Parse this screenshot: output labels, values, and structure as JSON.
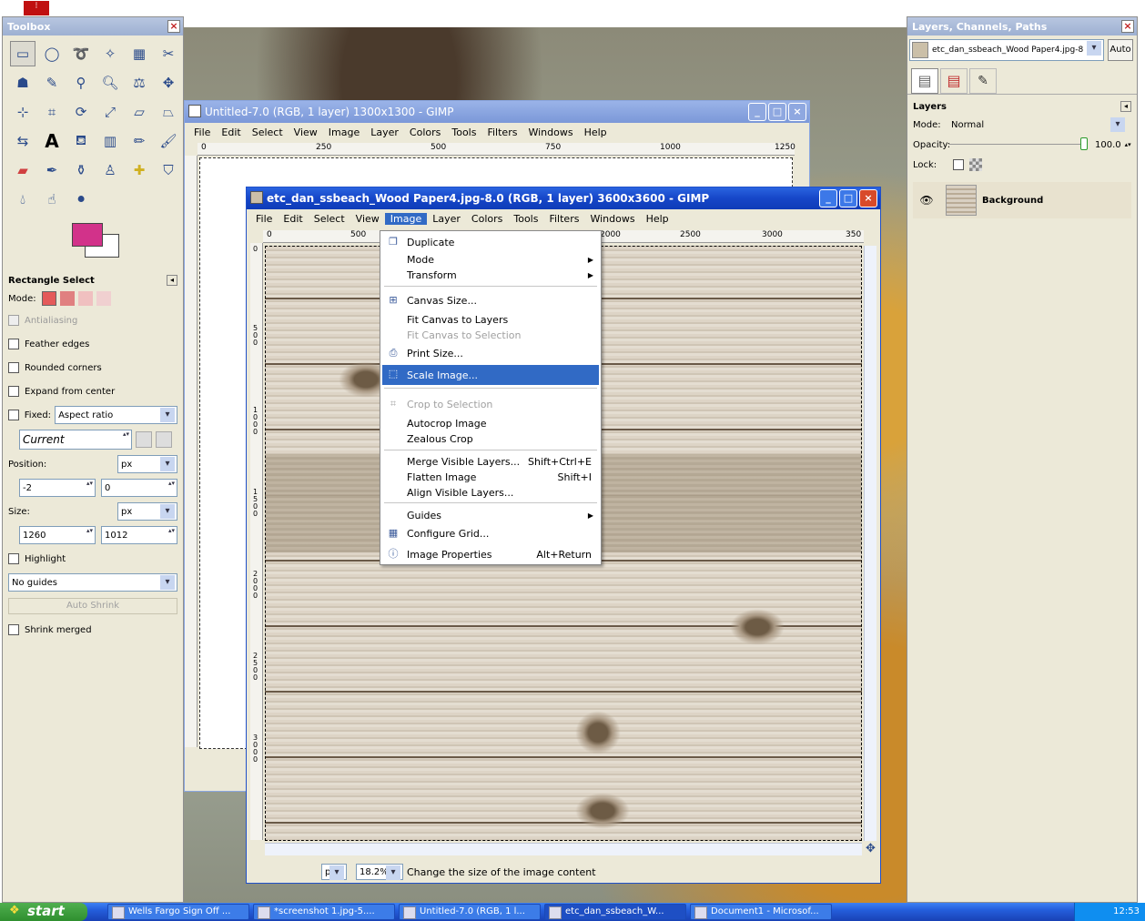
{
  "toolbox": {
    "title": "Toolbox",
    "tools": [
      "rect-select",
      "ellipse-select",
      "free-select",
      "fuzzy-select",
      "select-by-color",
      "scissors",
      "foreground-select",
      "paths",
      "color-picker",
      "zoom",
      "measure",
      "move",
      "align",
      "crop",
      "rotate",
      "scale",
      "shear",
      "perspective",
      "flip",
      "text",
      "bucket-fill",
      "blend",
      "pencil",
      "paintbrush",
      "eraser",
      "airbrush",
      "ink",
      "clone",
      "heal",
      "perspective-clone",
      "blur",
      "smudge",
      "dodge-burn"
    ],
    "colors": {
      "foreground": "#d2328a",
      "background": "#ffffff"
    },
    "options": {
      "title": "Rectangle Select",
      "mode_label": "Mode:",
      "antialiasing": "Antialiasing",
      "feather_edges": "Feather edges",
      "rounded_corners": "Rounded corners",
      "expand_from_center": "Expand from center",
      "fixed_label": "Fixed:",
      "fixed_value": "Aspect ratio",
      "current_value": "Current",
      "position_label": "Position:",
      "position_unit": "px",
      "position_x": "-2",
      "position_y": "0",
      "size_label": "Size:",
      "size_unit": "px",
      "size_w": "1260",
      "size_h": "1012",
      "highlight": "Highlight",
      "guides_value": "No guides",
      "auto_shrink": "Auto Shrink",
      "shrink_merged": "Shrink merged"
    }
  },
  "back_window": {
    "title": "Untitled-7.0 (RGB, 1 layer) 1300x1300 - GIMP",
    "menus": [
      "File",
      "Edit",
      "Select",
      "View",
      "Image",
      "Layer",
      "Colors",
      "Tools",
      "Filters",
      "Windows",
      "Help"
    ],
    "ruler_h": [
      "0",
      "250",
      "500",
      "750",
      "1000",
      "1250"
    ]
  },
  "front_window": {
    "title": "etc_dan_ssbeach_Wood Paper4.jpg-8.0 (RGB, 1 layer) 3600x3600 - GIMP",
    "menus": [
      "File",
      "Edit",
      "Select",
      "View",
      "Image",
      "Layer",
      "Colors",
      "Tools",
      "Filters",
      "Windows",
      "Help"
    ],
    "ruler_h": [
      "0",
      "500",
      "2000",
      "2500",
      "3000",
      "350"
    ],
    "ruler_v": [
      "0",
      "500",
      "1000",
      "1500",
      "2000",
      "2500",
      "3000"
    ],
    "status": {
      "unit": "px",
      "zoom": "18.2%",
      "message": "Change the size of the image content"
    }
  },
  "image_menu": {
    "items": {
      "duplicate": "Duplicate",
      "mode": "Mode",
      "transform": "Transform",
      "canvas_size": "Canvas Size...",
      "fit_canvas_layers": "Fit Canvas to Layers",
      "fit_canvas_selection": "Fit Canvas to Selection",
      "print_size": "Print Size...",
      "scale_image": "Scale Image...",
      "crop_to_selection": "Crop to Selection",
      "autocrop_image": "Autocrop Image",
      "zealous_crop": "Zealous Crop",
      "merge_visible": "Merge Visible Layers...",
      "merge_visible_sc": "Shift+Ctrl+E",
      "flatten_image": "Flatten Image",
      "flatten_image_sc": "Shift+I",
      "align_visible": "Align Visible Layers...",
      "guides": "Guides",
      "configure_grid": "Configure Grid...",
      "image_properties": "Image Properties",
      "image_properties_sc": "Alt+Return"
    }
  },
  "layers_dock": {
    "title": "Layers, Channels, Paths",
    "image_select": "etc_dan_ssbeach_Wood Paper4.jpg-8",
    "auto_label": "Auto",
    "section_title": "Layers",
    "mode_label": "Mode:",
    "mode_value": "Normal",
    "opacity_label": "Opacity:",
    "opacity_value": "100.0",
    "opacity_fraction": 1.0,
    "lock_label": "Lock:",
    "layer_name": "Background"
  },
  "taskbar": {
    "start_label": "start",
    "tasks": [
      "Wells Fargo Sign Off ...",
      "*screenshot 1.jpg-5....",
      "Untitled-7.0 (RGB, 1 l...",
      "etc_dan_ssbeach_W...",
      "Document1 - Microsof..."
    ],
    "clock": "12:53"
  }
}
